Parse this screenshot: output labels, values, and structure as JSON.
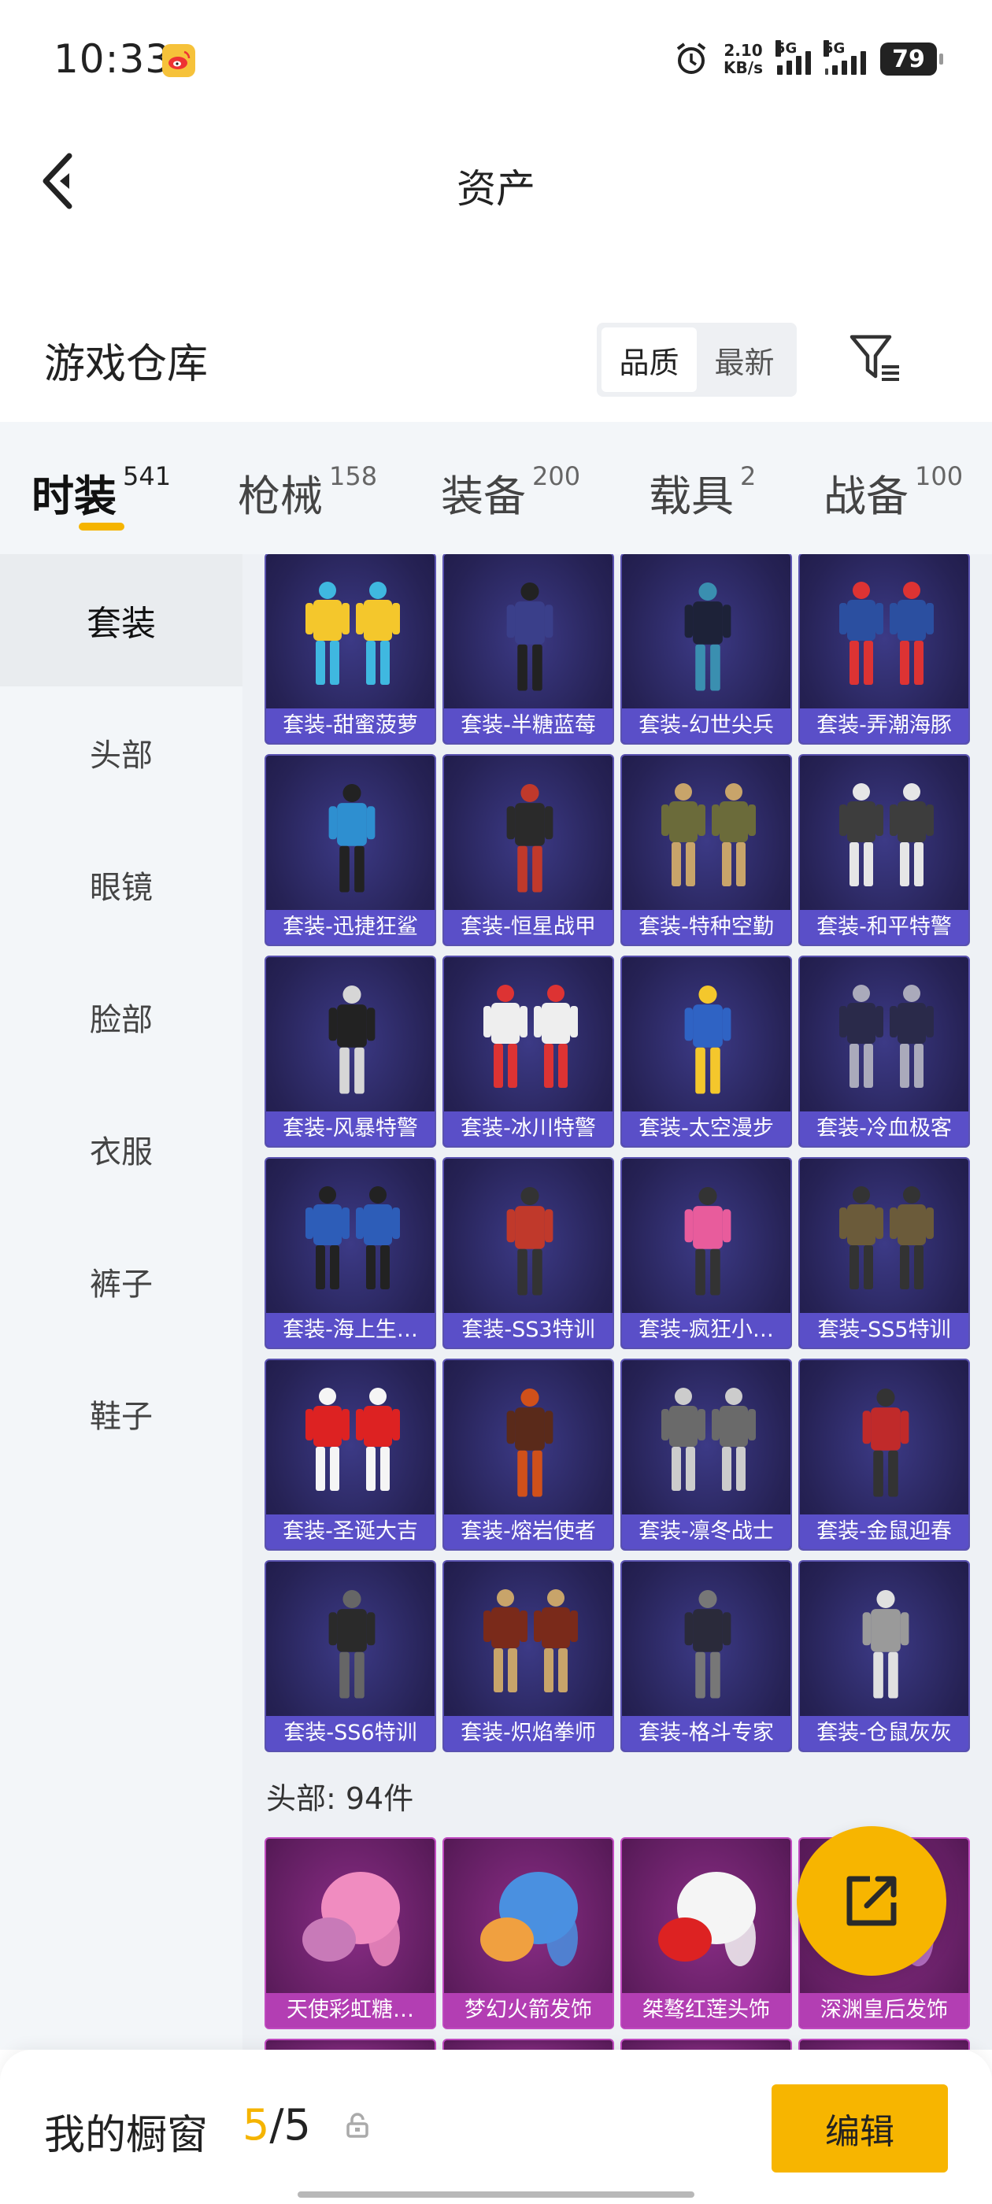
{
  "status_bar": {
    "time": "10:33",
    "net_speed_value": "2.10",
    "net_speed_unit": "KB/s",
    "signal1_label": "5G",
    "signal2_label": "5G",
    "battery": "79",
    "icons": [
      "weibo-icon",
      "alarm-icon",
      "signal-icon",
      "battery-icon"
    ]
  },
  "nav": {
    "title": "资产",
    "back_icon": "back-chevron-icon"
  },
  "warehouse": {
    "title": "游戏仓库",
    "sort_options": [
      "品质",
      "最新"
    ],
    "sort_selected": "品质",
    "filter_icon": "filter-icon"
  },
  "categories": [
    {
      "name": "时装",
      "count": "541",
      "active": true
    },
    {
      "name": "枪械",
      "count": "158",
      "active": false
    },
    {
      "name": "装备",
      "count": "200",
      "active": false
    },
    {
      "name": "载具",
      "count": "2",
      "active": false
    },
    {
      "name": "战备",
      "count": "100",
      "active": false
    }
  ],
  "sidebar": [
    {
      "label": "套装",
      "active": true
    },
    {
      "label": "头部",
      "active": false
    },
    {
      "label": "眼镜",
      "active": false
    },
    {
      "label": "脸部",
      "active": false
    },
    {
      "label": "衣服",
      "active": false
    },
    {
      "label": "裤子",
      "active": false
    },
    {
      "label": "鞋子",
      "active": false
    }
  ],
  "suits": [
    "套装-甜蜜菠萝",
    "套装-半糖蓝莓",
    "套装-幻世尖兵",
    "套装-弄潮海豚",
    "套装-迅捷狂鲨",
    "套装-恒星战甲",
    "套装-特种空勤",
    "套装-和平特警",
    "套装-风暴特警",
    "套装-冰川特警",
    "套装-太空漫步",
    "套装-冷血极客",
    "套装-海上生…",
    "套装-SS3特训",
    "套装-疯狂小…",
    "套装-SS5特训",
    "套装-圣诞大吉",
    "套装-熔岩使者",
    "套装-凛冬战士",
    "套装-金鼠迎春",
    "套装-SS6特训",
    "套装-炽焰拳师",
    "套装-格斗专家",
    "套装-仓鼠灰灰"
  ],
  "head_section": {
    "title": "头部: 94件",
    "items": [
      "天使彩虹糖…",
      "梦幻火箭发饰",
      "桀骜红莲头饰",
      "深渊皇后发饰"
    ]
  },
  "bottom": {
    "label": "我的橱窗",
    "current": "5",
    "total": "/5",
    "edit_label": "编辑"
  },
  "colors": {
    "accent": "#f7b500",
    "card_purple": "#5a4fc8",
    "card_pink": "#b33eb3"
  }
}
